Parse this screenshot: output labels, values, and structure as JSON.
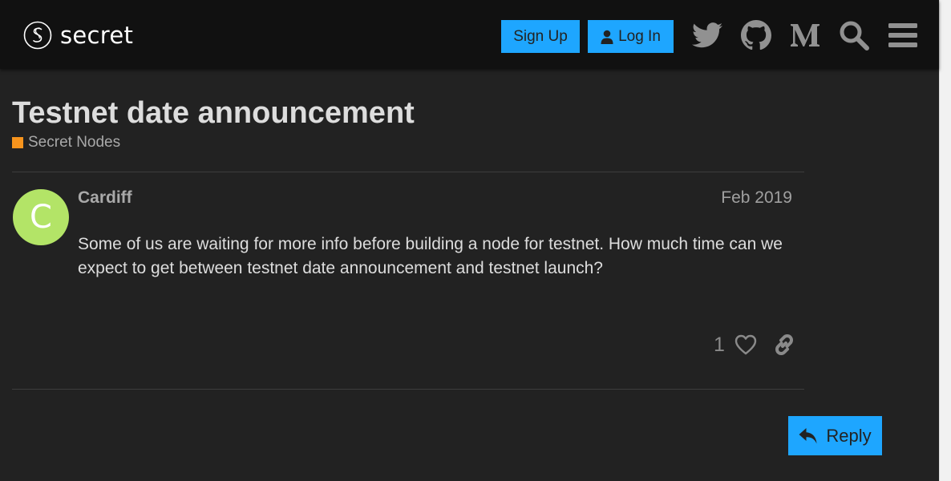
{
  "header": {
    "logo_text": "secret",
    "signup_label": "Sign Up",
    "login_label": "Log In",
    "icons": [
      "twitter-icon",
      "github-icon",
      "medium-icon",
      "search-icon",
      "hamburger-menu-icon"
    ]
  },
  "topic": {
    "title": "Testnet date announcement",
    "category": "Secret Nodes",
    "category_color": "#f7941d"
  },
  "post": {
    "avatar_letter": "C",
    "avatar_color": "#b3e467",
    "username": "Cardiff",
    "date": "Feb 2019",
    "body": "Some of us are waiting for more info before building a node for testnet. How much time can we expect to get between testnet date announcement and testnet launch?",
    "like_count": "1"
  },
  "footer": {
    "reply_label": "Reply"
  },
  "colors": {
    "background": "#222222",
    "header": "#111111",
    "accent": "#1ea6ff",
    "text": "#dddddd",
    "muted": "#a9a9a9"
  }
}
